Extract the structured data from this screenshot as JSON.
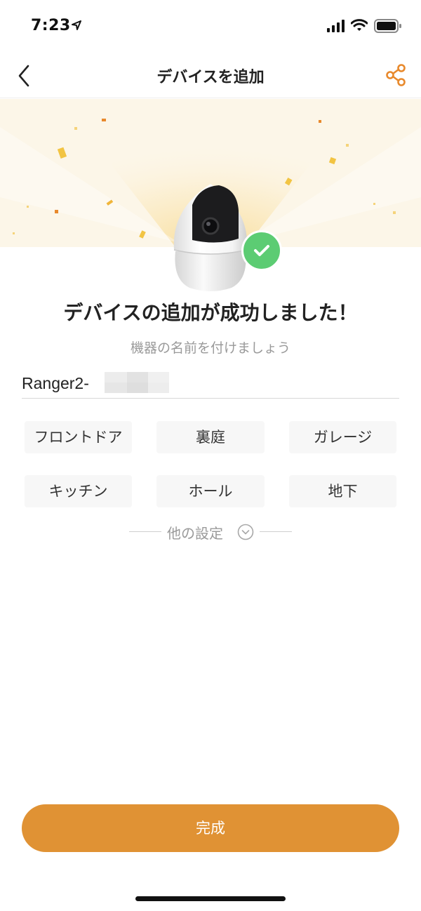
{
  "status_bar": {
    "time": "7:23",
    "icons": [
      "location-arrow-icon",
      "cellular-signal-icon",
      "wifi-icon",
      "battery-icon"
    ]
  },
  "nav": {
    "title": "デバイスを追加",
    "back_icon": "chevron-left-icon",
    "share_icon": "share-icon",
    "accent_color": "#e8892c"
  },
  "hero": {
    "image": "camera-device",
    "badge_icon": "check-icon",
    "badge_color": "#5ccc73"
  },
  "main": {
    "title": "デバイスの追加が成功しました！",
    "subtitle": "機器の名前を付けましょう",
    "device_name": "Ranger2-"
  },
  "name_presets": [
    "フロントドア",
    "裏庭",
    "ガレージ",
    "キッチン",
    "ホール",
    "地下"
  ],
  "more_settings": {
    "label": "他の設定",
    "icon": "chevron-down-circle-icon"
  },
  "done_button": {
    "label": "完成",
    "color": "#e09234"
  }
}
